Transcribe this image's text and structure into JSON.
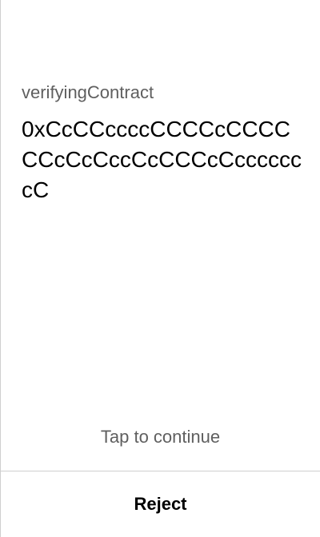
{
  "field": {
    "label": "verifyingContract",
    "value": "0xCcCCccccCCCCcCCCCCCcCcCccCcCCCcCcccccccC"
  },
  "tap_hint": "Tap to continue",
  "footer": {
    "reject_label": "Reject"
  }
}
